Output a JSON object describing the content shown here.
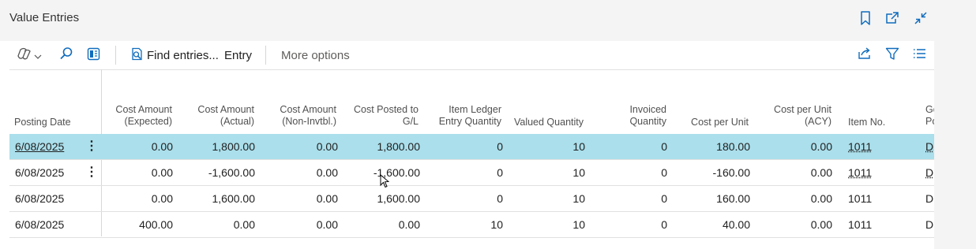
{
  "window": {
    "title": "Value Entries"
  },
  "toolbar": {
    "copilot_icon": "copilot-icon",
    "find_entries_label": "Find entries...",
    "entry_label": "Entry",
    "more_options_label": "More options"
  },
  "columns": {
    "posting_date": "Posting Date",
    "cost_expected": [
      "Cost Amount",
      "(Expected)"
    ],
    "cost_actual": [
      "Cost Amount",
      "(Actual)"
    ],
    "cost_noninv": [
      "Cost Amount",
      "(Non-Invtbl.)"
    ],
    "cost_posted": [
      "Cost Posted to",
      "G/L"
    ],
    "ile_qty": [
      "Item Ledger",
      "Entry Quantity"
    ],
    "valued_qty": "Valued Quantity",
    "invoiced_qty": [
      "Invoiced",
      "Quantity"
    ],
    "cost_per_unit": "Cost per Unit",
    "cost_per_unit_acy": [
      "Cost per Unit",
      "(ACY)"
    ],
    "item_no": "Item No.",
    "next_col": [
      "Ge",
      "Po"
    ]
  },
  "rows": [
    {
      "posting_date": "6/08/2025",
      "cost_expected": "0.00",
      "cost_actual": "1,800.00",
      "cost_noninv": "0.00",
      "cost_posted": "1,800.00",
      "ile_qty": "0",
      "valued_qty": "10",
      "invoiced_qty": "0",
      "cost_per_unit": "180.00",
      "cost_per_unit_acy": "0.00",
      "item_no": "1011",
      "next": "D"
    },
    {
      "posting_date": "6/08/2025",
      "cost_expected": "0.00",
      "cost_actual": "-1,600.00",
      "cost_noninv": "0.00",
      "cost_posted": "-1,600.00",
      "ile_qty": "0",
      "valued_qty": "10",
      "invoiced_qty": "0",
      "cost_per_unit": "-160.00",
      "cost_per_unit_acy": "0.00",
      "item_no": "1011",
      "next": "D"
    },
    {
      "posting_date": "6/08/2025",
      "cost_expected": "0.00",
      "cost_actual": "1,600.00",
      "cost_noninv": "0.00",
      "cost_posted": "1,600.00",
      "ile_qty": "0",
      "valued_qty": "10",
      "invoiced_qty": "0",
      "cost_per_unit": "160.00",
      "cost_per_unit_acy": "0.00",
      "item_no": "1011",
      "next": "D"
    },
    {
      "posting_date": "6/08/2025",
      "cost_expected": "400.00",
      "cost_actual": "0.00",
      "cost_noninv": "0.00",
      "cost_posted": "0.00",
      "ile_qty": "10",
      "valued_qty": "10",
      "invoiced_qty": "0",
      "cost_per_unit": "40.00",
      "cost_per_unit_acy": "0.00",
      "item_no": "1011",
      "next": "D"
    }
  ],
  "colors": {
    "selected_row": "#aadfeb",
    "accent": "#0f6cbd"
  }
}
